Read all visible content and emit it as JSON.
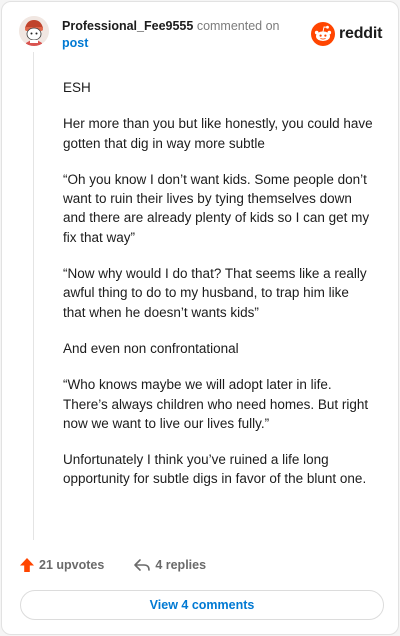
{
  "comment": {
    "username": "Professional_Fee9555",
    "action_text": "commented on",
    "post_link": "post",
    "brand": "reddit",
    "paragraphs": [
      "ESH",
      "Her more than you but like honestly, you could have gotten that dig in way more subtle",
      "“Oh you know I don’t want kids. Some people don’t want to ruin their lives by tying themselves down and there are already plenty of kids so I can get my fix that way”",
      "“Now why would I do that? That seems like a really awful thing to do to my husband, to trap him like that when he doesn’t wants kids”",
      "And even non confrontational",
      "“Who knows maybe we will adopt later in life. There’s always children who need homes. But right now we want to live our lives fully.”",
      "Unfortunately I think you’ve ruined a life long opportunity for subtle digs in favor of the blunt one."
    ],
    "upvotes_label": "21 upvotes",
    "replies_label": "4 replies",
    "view_comments_label": "View 4 comments"
  },
  "colors": {
    "upvote_accent": "#ff4500",
    "link": "#0079d3"
  },
  "icons": [
    "avatar",
    "reddit-logo-icon",
    "upvote-arrow-icon",
    "reply-arrow-icon"
  ]
}
